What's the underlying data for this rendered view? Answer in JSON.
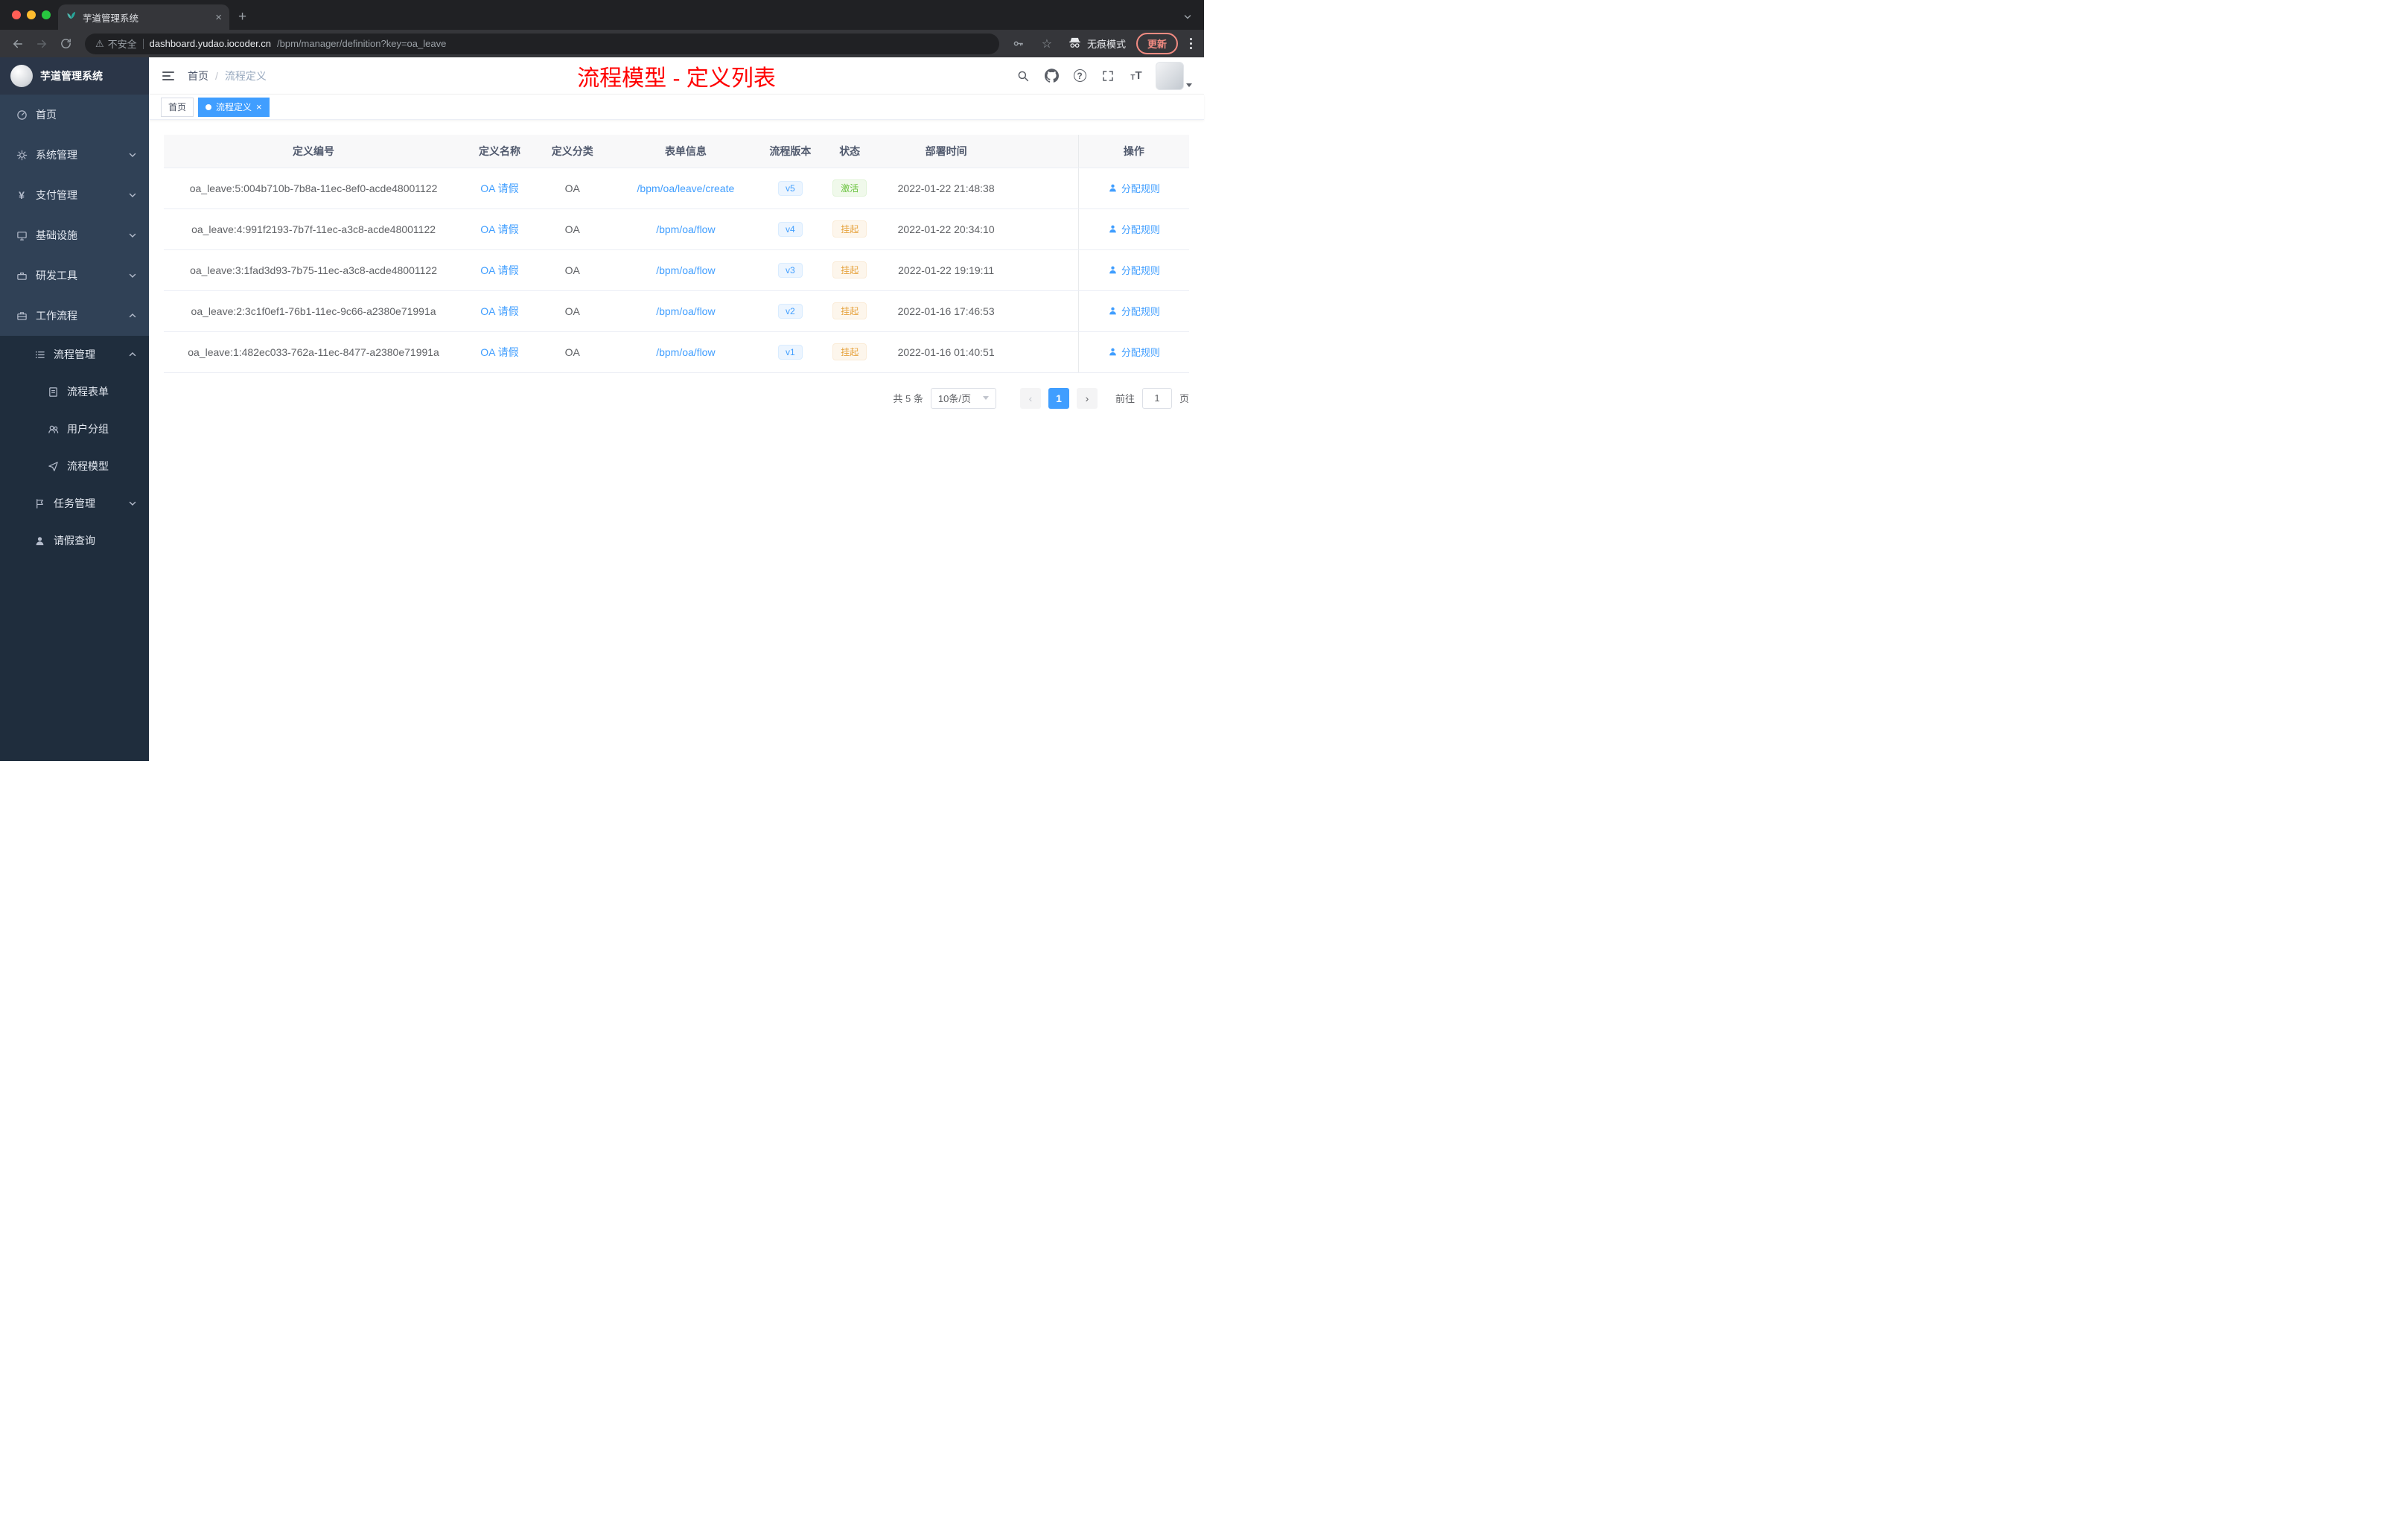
{
  "browser": {
    "tab_title": "芋道管理系统",
    "security_label": "不安全",
    "url_host": "dashboard.yudao.iocoder.cn",
    "url_path": "/bpm/manager/definition?key=oa_leave",
    "incognito_label": "无痕模式",
    "update_label": "更新"
  },
  "sidebar": {
    "logo_title": "芋道管理系统",
    "items": [
      {
        "label": "首页",
        "icon": "dashboard-icon",
        "level": 1,
        "expandable": false
      },
      {
        "label": "系统管理",
        "icon": "gear-icon",
        "level": 1,
        "expandable": true,
        "expanded": false
      },
      {
        "label": "支付管理",
        "icon": "yen-icon",
        "level": 1,
        "expandable": true,
        "expanded": false
      },
      {
        "label": "基础设施",
        "icon": "monitor-icon",
        "level": 1,
        "expandable": true,
        "expanded": false
      },
      {
        "label": "研发工具",
        "icon": "toolbox-icon",
        "level": 1,
        "expandable": true,
        "expanded": false
      },
      {
        "label": "工作流程",
        "icon": "briefcase-icon",
        "level": 1,
        "expandable": true,
        "expanded": true
      },
      {
        "label": "流程管理",
        "icon": "list-icon",
        "level": 2,
        "expandable": true,
        "expanded": true
      },
      {
        "label": "流程表单",
        "icon": "form-icon",
        "level": 3,
        "expandable": false
      },
      {
        "label": "用户分组",
        "icon": "users-icon",
        "level": 3,
        "expandable": false
      },
      {
        "label": "流程模型",
        "icon": "paper-plane-icon",
        "level": 3,
        "expandable": false
      },
      {
        "label": "任务管理",
        "icon": "flag-icon",
        "level": 2,
        "expandable": true,
        "expanded": false
      },
      {
        "label": "请假查询",
        "icon": "person-icon",
        "level": 2,
        "expandable": false
      }
    ]
  },
  "header": {
    "breadcrumb": {
      "home": "首页",
      "separator": "/",
      "current": "流程定义"
    },
    "annotation": "流程模型 - 定义列表",
    "annotation_color": "#ff0000"
  },
  "tags": {
    "items": [
      {
        "label": "首页",
        "active": false
      },
      {
        "label": "流程定义",
        "active": true,
        "close": "×"
      }
    ]
  },
  "table": {
    "columns": {
      "id": "定义编号",
      "name": "定义名称",
      "category": "定义分类",
      "form": "表单信息",
      "version": "流程版本",
      "status": "状态",
      "deployed_at": "部署时间",
      "action": "操作"
    },
    "rows": [
      {
        "id": "oa_leave:5:004b710b-7b8a-11ec-8ef0-acde48001122",
        "name": "OA 请假",
        "category": "OA",
        "form": "/bpm/oa/leave/create",
        "version": "v5",
        "status": "激活",
        "status_type": "success",
        "deployed_at": "2022-01-22 21:48:38",
        "action": "分配规则"
      },
      {
        "id": "oa_leave:4:991f2193-7b7f-11ec-a3c8-acde48001122",
        "name": "OA 请假",
        "category": "OA",
        "form": "/bpm/oa/flow",
        "version": "v4",
        "status": "挂起",
        "status_type": "warning",
        "deployed_at": "2022-01-22 20:34:10",
        "action": "分配规则"
      },
      {
        "id": "oa_leave:3:1fad3d93-7b75-11ec-a3c8-acde48001122",
        "name": "OA 请假",
        "category": "OA",
        "form": "/bpm/oa/flow",
        "version": "v3",
        "status": "挂起",
        "status_type": "warning",
        "deployed_at": "2022-01-22 19:19:11",
        "action": "分配规则"
      },
      {
        "id": "oa_leave:2:3c1f0ef1-76b1-11ec-9c66-a2380e71991a",
        "name": "OA 请假",
        "category": "OA",
        "form": "/bpm/oa/flow",
        "version": "v2",
        "status": "挂起",
        "status_type": "warning",
        "deployed_at": "2022-01-16 17:46:53",
        "action": "分配规则"
      },
      {
        "id": "oa_leave:1:482ec033-762a-11ec-8477-a2380e71991a",
        "name": "OA 请假",
        "category": "OA",
        "form": "/bpm/oa/flow",
        "version": "v1",
        "status": "挂起",
        "status_type": "warning",
        "deployed_at": "2022-01-16 01:40:51",
        "action": "分配规则"
      }
    ]
  },
  "pagination": {
    "total": "共 5 条",
    "page_size": "10条/页",
    "current_page": "1",
    "goto_label": "前往",
    "goto_value": "1",
    "page_unit": "页"
  },
  "colors": {
    "accent_blue": "#409eff",
    "success_green": "#67c23a",
    "warning_orange": "#e6a23c",
    "annotation_red": "#ff0000",
    "sidebar_bg": "#304156",
    "submenu_bg": "#1f2d3d"
  },
  "icons": {
    "browser": [
      "back-icon",
      "forward-icon",
      "reload-icon",
      "warning-icon",
      "key-icon",
      "star-icon",
      "incognito-icon",
      "kebab-menu-icon",
      "new-tab-icon",
      "tab-search-icon",
      "close-icon"
    ],
    "navbar": [
      "hamburger-icon",
      "search-icon",
      "github-icon",
      "question-icon",
      "fullscreen-icon",
      "font-size-icon",
      "caret-down-icon"
    ],
    "table": [
      "user-icon"
    ]
  }
}
